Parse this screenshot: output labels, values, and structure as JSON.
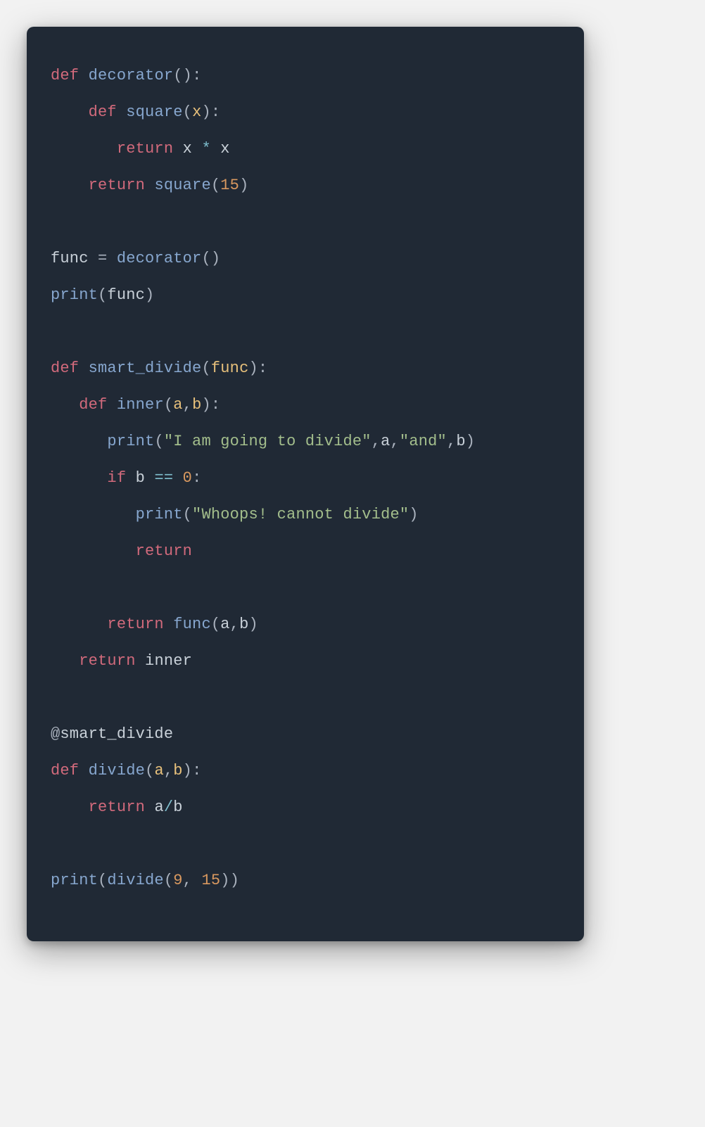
{
  "tokens": {
    "def": "def",
    "return": "return",
    "if": "if",
    "decorator": "decorator",
    "square": "square",
    "x": "x",
    "func_ident": "func",
    "print": "print",
    "smart_divide": "smart_divide",
    "inner": "inner",
    "a": "a",
    "b": "b",
    "divide": "divide",
    "star": "*",
    "eqeq": "==",
    "slash": "/",
    "eq": "=",
    "at": "@",
    "lp": "(",
    "rp": ")",
    "colon": ":",
    "comma": ","
  },
  "strings": {
    "going": "\"I am going to divide\"",
    "and": "\"and\"",
    "whoops": "\"Whoops! cannot divide\""
  },
  "numbers": {
    "n15": "15",
    "n0": "0",
    "n9": "9"
  }
}
